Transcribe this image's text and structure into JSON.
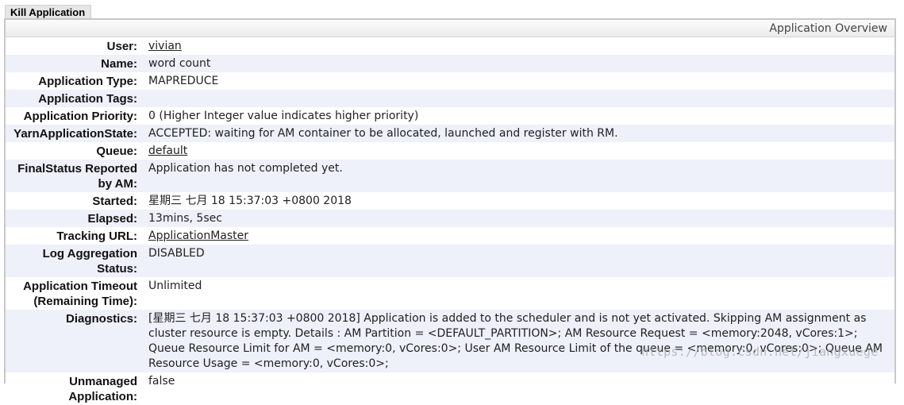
{
  "kill_button_label": "Kill Application",
  "panel_title": "Application Overview",
  "rows": [
    {
      "label": "User:",
      "value": "vivian",
      "link": true
    },
    {
      "label": "Name:",
      "value": "word count",
      "link": false
    },
    {
      "label": "Application Type:",
      "value": "MAPREDUCE",
      "link": false
    },
    {
      "label": "Application Tags:",
      "value": "",
      "link": false
    },
    {
      "label": "Application Priority:",
      "value": "0 (Higher Integer value indicates higher priority)",
      "link": false
    },
    {
      "label": "YarnApplicationState:",
      "value": "ACCEPTED: waiting for AM container to be allocated, launched and register with RM.",
      "link": false
    },
    {
      "label": "Queue:",
      "value": "default",
      "link": true
    },
    {
      "label": "FinalStatus Reported by AM:",
      "value": "Application has not completed yet.",
      "link": false
    },
    {
      "label": "Started:",
      "value": "星期三 七月 18 15:37:03 +0800 2018",
      "link": false
    },
    {
      "label": "Elapsed:",
      "value": "13mins, 5sec",
      "link": false
    },
    {
      "label": "Tracking URL:",
      "value": "ApplicationMaster",
      "link": true
    },
    {
      "label": "Log Aggregation Status:",
      "value": "DISABLED",
      "link": false
    },
    {
      "label": "Application Timeout (Remaining Time):",
      "value": "Unlimited",
      "link": false
    },
    {
      "label": "Diagnostics:",
      "value": "[星期三 七月 18 15:37:03 +0800 2018] Application is added to the scheduler and is not yet activated. Skipping AM assignment as cluster resource is empty. Details : AM Partition = <DEFAULT_PARTITION>; AM Resource Request = <memory:2048, vCores:1>; Queue Resource Limit for AM = <memory:0, vCores:0>; User AM Resource Limit of the queue = <memory:0, vCores:0>; Queue AM Resource Usage = <memory:0, vCores:0>;",
      "link": false
    },
    {
      "label": "Unmanaged Application:",
      "value": "false",
      "link": false
    }
  ],
  "watermark": "https://blog.csdn.net/jiangxuege"
}
